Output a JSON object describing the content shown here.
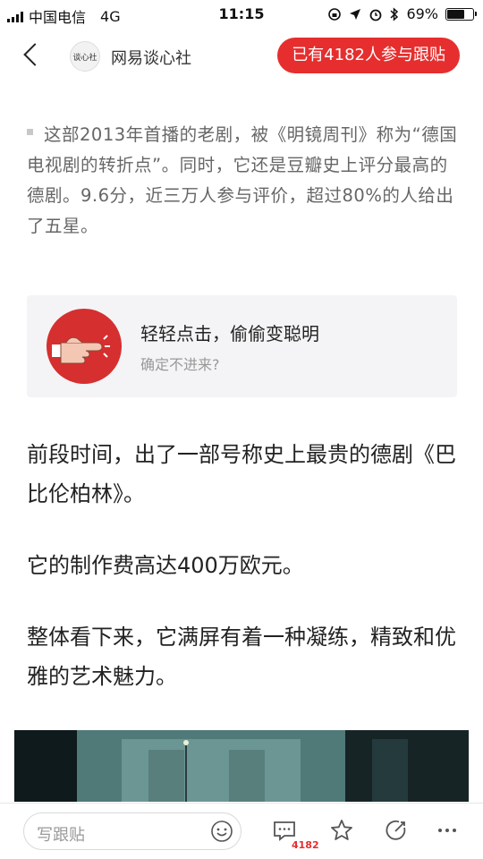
{
  "status_bar": {
    "carrier": "中国电信",
    "network": "4G",
    "time": "11:15",
    "battery": "69%",
    "battery_level": 0.69
  },
  "nav": {
    "logo_text": "谈心社",
    "source_name": "网易谈心社",
    "follow_button": "已有4182人参与跟贴"
  },
  "article": {
    "quote": "这部2013年首播的老剧，被《明镜周刊》称为“德国电视剧的转折点”。同时，它还是豆瓣史上评分最高的德剧。9.6分，近三万人参与评价，超过80%的人给出了五星。",
    "promo_card": {
      "title": "轻轻点击，偷偷变聪明",
      "subtitle": "确定不进来?"
    },
    "paragraphs": [
      "前段时间，出了一部号称史上最贵的德剧《巴比伦柏林》。",
      "它的制作费高达400万欧元。",
      "整体看下来，它满屏有着一种凝练，精致和优雅的艺术魅力。"
    ]
  },
  "bottom_bar": {
    "comment_placeholder": "写跟贴",
    "comment_count": "4182"
  },
  "colors": {
    "accent_red": "#e62e2e",
    "card_bg": "#f4f4f6",
    "quote_text": "#666666"
  }
}
